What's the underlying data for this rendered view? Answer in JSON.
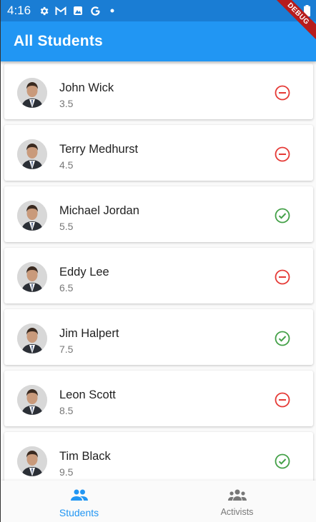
{
  "status_bar": {
    "time": "4:16",
    "icons_left": [
      "gear-icon",
      "gmail-icon",
      "photos-icon",
      "google-icon",
      "dot-icon"
    ],
    "icons_right": [
      "wifi-icon",
      "battery-icon"
    ]
  },
  "debug_banner": "DEBUG",
  "app_bar": {
    "title": "All Students"
  },
  "students": [
    {
      "name": "John Wick",
      "score": "3.5",
      "status": "remove",
      "status_icon": "remove-circle-icon"
    },
    {
      "name": "Terry Medhurst",
      "score": "4.5",
      "status": "remove",
      "status_icon": "remove-circle-icon"
    },
    {
      "name": "Michael Jordan",
      "score": "5.5",
      "status": "checked",
      "status_icon": "check-circle-icon"
    },
    {
      "name": "Eddy Lee",
      "score": "6.5",
      "status": "remove",
      "status_icon": "remove-circle-icon"
    },
    {
      "name": "Jim Halpert",
      "score": "7.5",
      "status": "checked",
      "status_icon": "check-circle-icon"
    },
    {
      "name": "Leon Scott",
      "score": "8.5",
      "status": "remove",
      "status_icon": "remove-circle-icon"
    },
    {
      "name": "Tim Black",
      "score": "9.5",
      "status": "checked",
      "status_icon": "check-circle-icon"
    }
  ],
  "bottom_nav": [
    {
      "label": "Students",
      "icon": "people-icon",
      "active": true
    },
    {
      "label": "Activists",
      "icon": "groups-icon",
      "active": false
    }
  ],
  "colors": {
    "primary": "#2196f3",
    "status_bar": "#1a7dd4",
    "remove_red": "#e53935",
    "check_green": "#43a047"
  }
}
